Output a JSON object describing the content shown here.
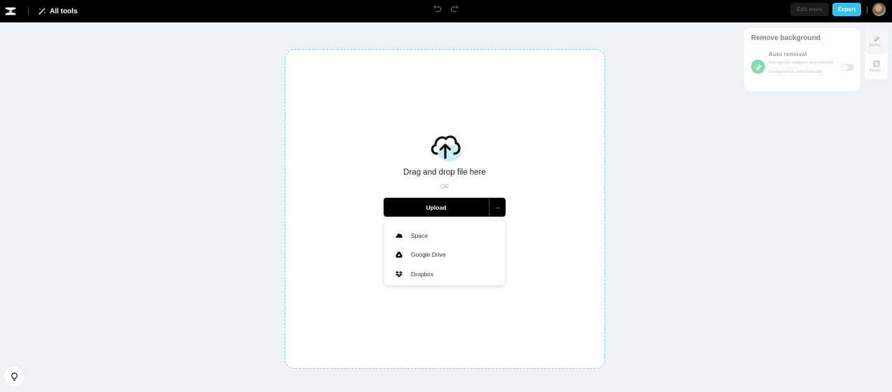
{
  "topbar": {
    "all_tools_label": "All tools",
    "edit_more_label": "Edit more",
    "export_label": "Export",
    "export_color": "#33c2ee"
  },
  "upload": {
    "drag_text": "Drag and drop file here",
    "or_text": "OR",
    "upload_label": "Upload",
    "more_label": "···",
    "menu": [
      {
        "icon": "cloud-icon",
        "label": "Space"
      },
      {
        "icon": "google-drive-icon",
        "label": "Google Drive"
      },
      {
        "icon": "dropbox-icon",
        "label": "Dropbox"
      }
    ]
  },
  "panel": {
    "title": "Remove background",
    "option_title": "Auto removal",
    "option_desc": "Recognize subjects and remove backgrounds automatically.",
    "toggle_on": false
  },
  "side_tabs": [
    {
      "icon": "eraser-icon",
      "label": "Remov..."
    },
    {
      "icon": "background-icon",
      "label": "Backgr..."
    }
  ]
}
